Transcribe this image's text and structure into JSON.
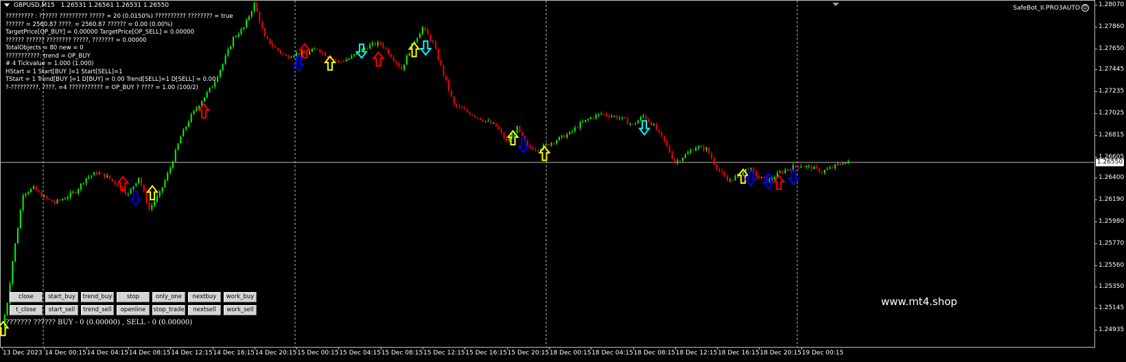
{
  "header": {
    "symbol": "GBPUSD,M15",
    "ohlc": "1.26531 1.26561 1.26531 1.26550"
  },
  "ea_name": "SafeBot_II.PRO3AUTO",
  "info_lines": [
    "????????? : ?????? ?????????  ????? = 20 (0.0150%) ?????????? ???????? = true",
    "?????? = 2560.87 ????. = 2560.87 ?????? = 0.00 (0.00%)",
    "TargetPrice[OP_BUY] = 0.00000 TargetPrice[OP_SELL] = 0.00000",
    "?????? ?????? ???????? ?????, ??????? = 0.00000",
    "TotalObjects = 80 new = 0",
    "???????????: trend = OP_BUY",
    "# 4 Tickvalue = 1.000 (1.000)",
    "HStart = 1 Start[BUY ]=1 Start[SELL]=1",
    "TStart = 1 Trend[BUY ]=1 D[BUY] = 0.00 Trend[SELL]=1 D[SELL] = 0.00",
    "?-?????????, ????, =4 ??????????? = OP_BUY ? ???? = 1.00 (100/2)"
  ],
  "buttons_row1": [
    "close",
    "start_buy",
    "trend_buy",
    "stop",
    "only_one",
    "nextbuy",
    "work_buy"
  ],
  "buttons_row2": [
    "t_close",
    "start_sell",
    "trend_sell",
    "openline",
    "stop_trade",
    "nextsell",
    "work_sell"
  ],
  "status_line": "??????? ?????? BUY - 0 (0.00000) , SELL - 0 (0.00000)",
  "watermark": "www.mt4.shop",
  "current_price": "1.26550",
  "price_axis": {
    "labels": [
      "1.28070",
      "1.27860",
      "1.27650",
      "1.27445",
      "1.27235",
      "1.27025",
      "1.26815",
      "1.26605",
      "1.26400",
      "1.26190",
      "1.25980",
      "1.25770",
      "1.25560",
      "1.25350",
      "1.25145",
      "1.24935"
    ],
    "min": 1.24935,
    "max": 1.2807
  },
  "time_axis": {
    "labels": [
      "13 Dec 2023",
      "14 Dec 00:15",
      "14 Dec 04:15",
      "14 Dec 08:15",
      "14 Dec 12:15",
      "14 Dec 16:15",
      "14 Dec 20:15",
      "15 Dec 00:15",
      "15 Dec 04:15",
      "15 Dec 08:15",
      "15 Dec 12:15",
      "15 Dec 16:15",
      "15 Dec 20:15",
      "18 Dec 00:15",
      "18 Dec 04:15",
      "18 Dec 08:15",
      "18 Dec 12:15",
      "18 Dec 16:15",
      "18 Dec 20:15",
      "19 Dec 00:15"
    ]
  },
  "colors": {
    "bull": "#00ff00",
    "bear": "#ff0000",
    "arrow_yellow": "#ffff00",
    "arrow_red": "#ff0000",
    "arrow_blue": "#0000ff",
    "arrow_cyan": "#00ffff",
    "grid": "#c0c0c0",
    "price_line": "#c0c0c0"
  },
  "chart_data": {
    "type": "candlestick",
    "price_path": [
      [
        0,
        1.2496
      ],
      [
        0.5,
        1.252
      ],
      [
        1,
        1.256
      ],
      [
        2,
        1.2625
      ],
      [
        3,
        1.263
      ],
      [
        4,
        1.2621
      ],
      [
        5,
        1.2616
      ],
      [
        6,
        1.2621
      ],
      [
        7,
        1.2627
      ],
      [
        8,
        1.264
      ],
      [
        9,
        1.2645
      ],
      [
        10,
        1.2641
      ],
      [
        11,
        1.2633
      ],
      [
        12,
        1.2624
      ],
      [
        13,
        1.2641
      ],
      [
        14,
        1.261
      ],
      [
        15,
        1.2625
      ],
      [
        16,
        1.265
      ],
      [
        17,
        1.268
      ],
      [
        18,
        1.27
      ],
      [
        19,
        1.2715
      ],
      [
        20,
        1.2729
      ],
      [
        21,
        1.275
      ],
      [
        22,
        1.2775
      ],
      [
        23,
        1.2785
      ],
      [
        24,
        1.2808
      ],
      [
        25,
        1.2775
      ],
      [
        26,
        1.2765
      ],
      [
        27,
        1.2757
      ],
      [
        28,
        1.276
      ],
      [
        29,
        1.276
      ],
      [
        30,
        1.2765
      ],
      [
        31,
        1.2757
      ],
      [
        32,
        1.2752
      ],
      [
        33,
        1.2755
      ],
      [
        34,
        1.2762
      ],
      [
        35,
        1.2768
      ],
      [
        36,
        1.277
      ],
      [
        37,
        1.2758
      ],
      [
        38,
        1.2745
      ],
      [
        39,
        1.2768
      ],
      [
        40,
        1.2785
      ],
      [
        41,
        1.277
      ],
      [
        42,
        1.274
      ],
      [
        43,
        1.271
      ],
      [
        44,
        1.2705
      ],
      [
        45,
        1.27
      ],
      [
        46,
        1.2695
      ],
      [
        47,
        1.269
      ],
      [
        48,
        1.2675
      ],
      [
        49,
        1.2688
      ],
      [
        50,
        1.267
      ],
      [
        51,
        1.2668
      ],
      [
        52,
        1.2673
      ],
      [
        53,
        1.2678
      ],
      [
        54,
        1.2683
      ],
      [
        55,
        1.2692
      ],
      [
        56,
        1.2698
      ],
      [
        57,
        1.2702
      ],
      [
        58,
        1.27
      ],
      [
        59,
        1.2697
      ],
      [
        60,
        1.2691
      ],
      [
        61,
        1.27
      ],
      [
        62,
        1.269
      ],
      [
        63,
        1.2675
      ],
      [
        64,
        1.2655
      ],
      [
        65,
        1.2662
      ],
      [
        66,
        1.267
      ],
      [
        67,
        1.2668
      ],
      [
        68,
        1.265
      ],
      [
        69,
        1.2637
      ],
      [
        70,
        1.2642
      ],
      [
        71,
        1.265
      ],
      [
        72,
        1.264
      ],
      [
        73,
        1.2638
      ],
      [
        74,
        1.2645
      ],
      [
        75,
        1.265
      ],
      [
        76,
        1.2652
      ],
      [
        77,
        1.265
      ],
      [
        78,
        1.2646
      ],
      [
        79,
        1.265
      ],
      [
        80,
        1.2655
      ],
      [
        80.5,
        1.2655
      ]
    ],
    "signal_arrows": [
      {
        "t": 0.1,
        "price": 1.2494,
        "dir": "up",
        "color": "yellow"
      },
      {
        "t": 11.5,
        "price": 1.2634,
        "dir": "up",
        "color": "red"
      },
      {
        "t": 12.7,
        "price": 1.2621,
        "dir": "down",
        "color": "blue"
      },
      {
        "t": 14.3,
        "price": 1.2625,
        "dir": "up",
        "color": "yellow"
      },
      {
        "t": 19.2,
        "price": 1.2704,
        "dir": "up",
        "color": "red"
      },
      {
        "t": 28.2,
        "price": 1.2751,
        "dir": "down",
        "color": "blue"
      },
      {
        "t": 28.8,
        "price": 1.2762,
        "dir": "up",
        "color": "red"
      },
      {
        "t": 31.2,
        "price": 1.275,
        "dir": "up",
        "color": "yellow"
      },
      {
        "t": 34.2,
        "price": 1.2763,
        "dir": "down",
        "color": "cyan"
      },
      {
        "t": 35.8,
        "price": 1.2754,
        "dir": "up",
        "color": "red"
      },
      {
        "t": 39.2,
        "price": 1.2763,
        "dir": "up",
        "color": "yellow"
      },
      {
        "t": 40.3,
        "price": 1.2766,
        "dir": "down",
        "color": "cyan"
      },
      {
        "t": 48.6,
        "price": 1.2678,
        "dir": "up",
        "color": "yellow"
      },
      {
        "t": 49.6,
        "price": 1.2672,
        "dir": "down",
        "color": "blue"
      },
      {
        "t": 51.6,
        "price": 1.2663,
        "dir": "up",
        "color": "yellow"
      },
      {
        "t": 61.1,
        "price": 1.2689,
        "dir": "down",
        "color": "cyan"
      },
      {
        "t": 70.5,
        "price": 1.2641,
        "dir": "up",
        "color": "yellow"
      },
      {
        "t": 71.2,
        "price": 1.264,
        "dir": "down",
        "color": "blue"
      },
      {
        "t": 72.9,
        "price": 1.2637,
        "dir": "down",
        "color": "blue"
      },
      {
        "t": 73.9,
        "price": 1.2635,
        "dir": "up",
        "color": "red"
      },
      {
        "t": 75.3,
        "price": 1.2641,
        "dir": "down",
        "color": "blue"
      }
    ]
  }
}
